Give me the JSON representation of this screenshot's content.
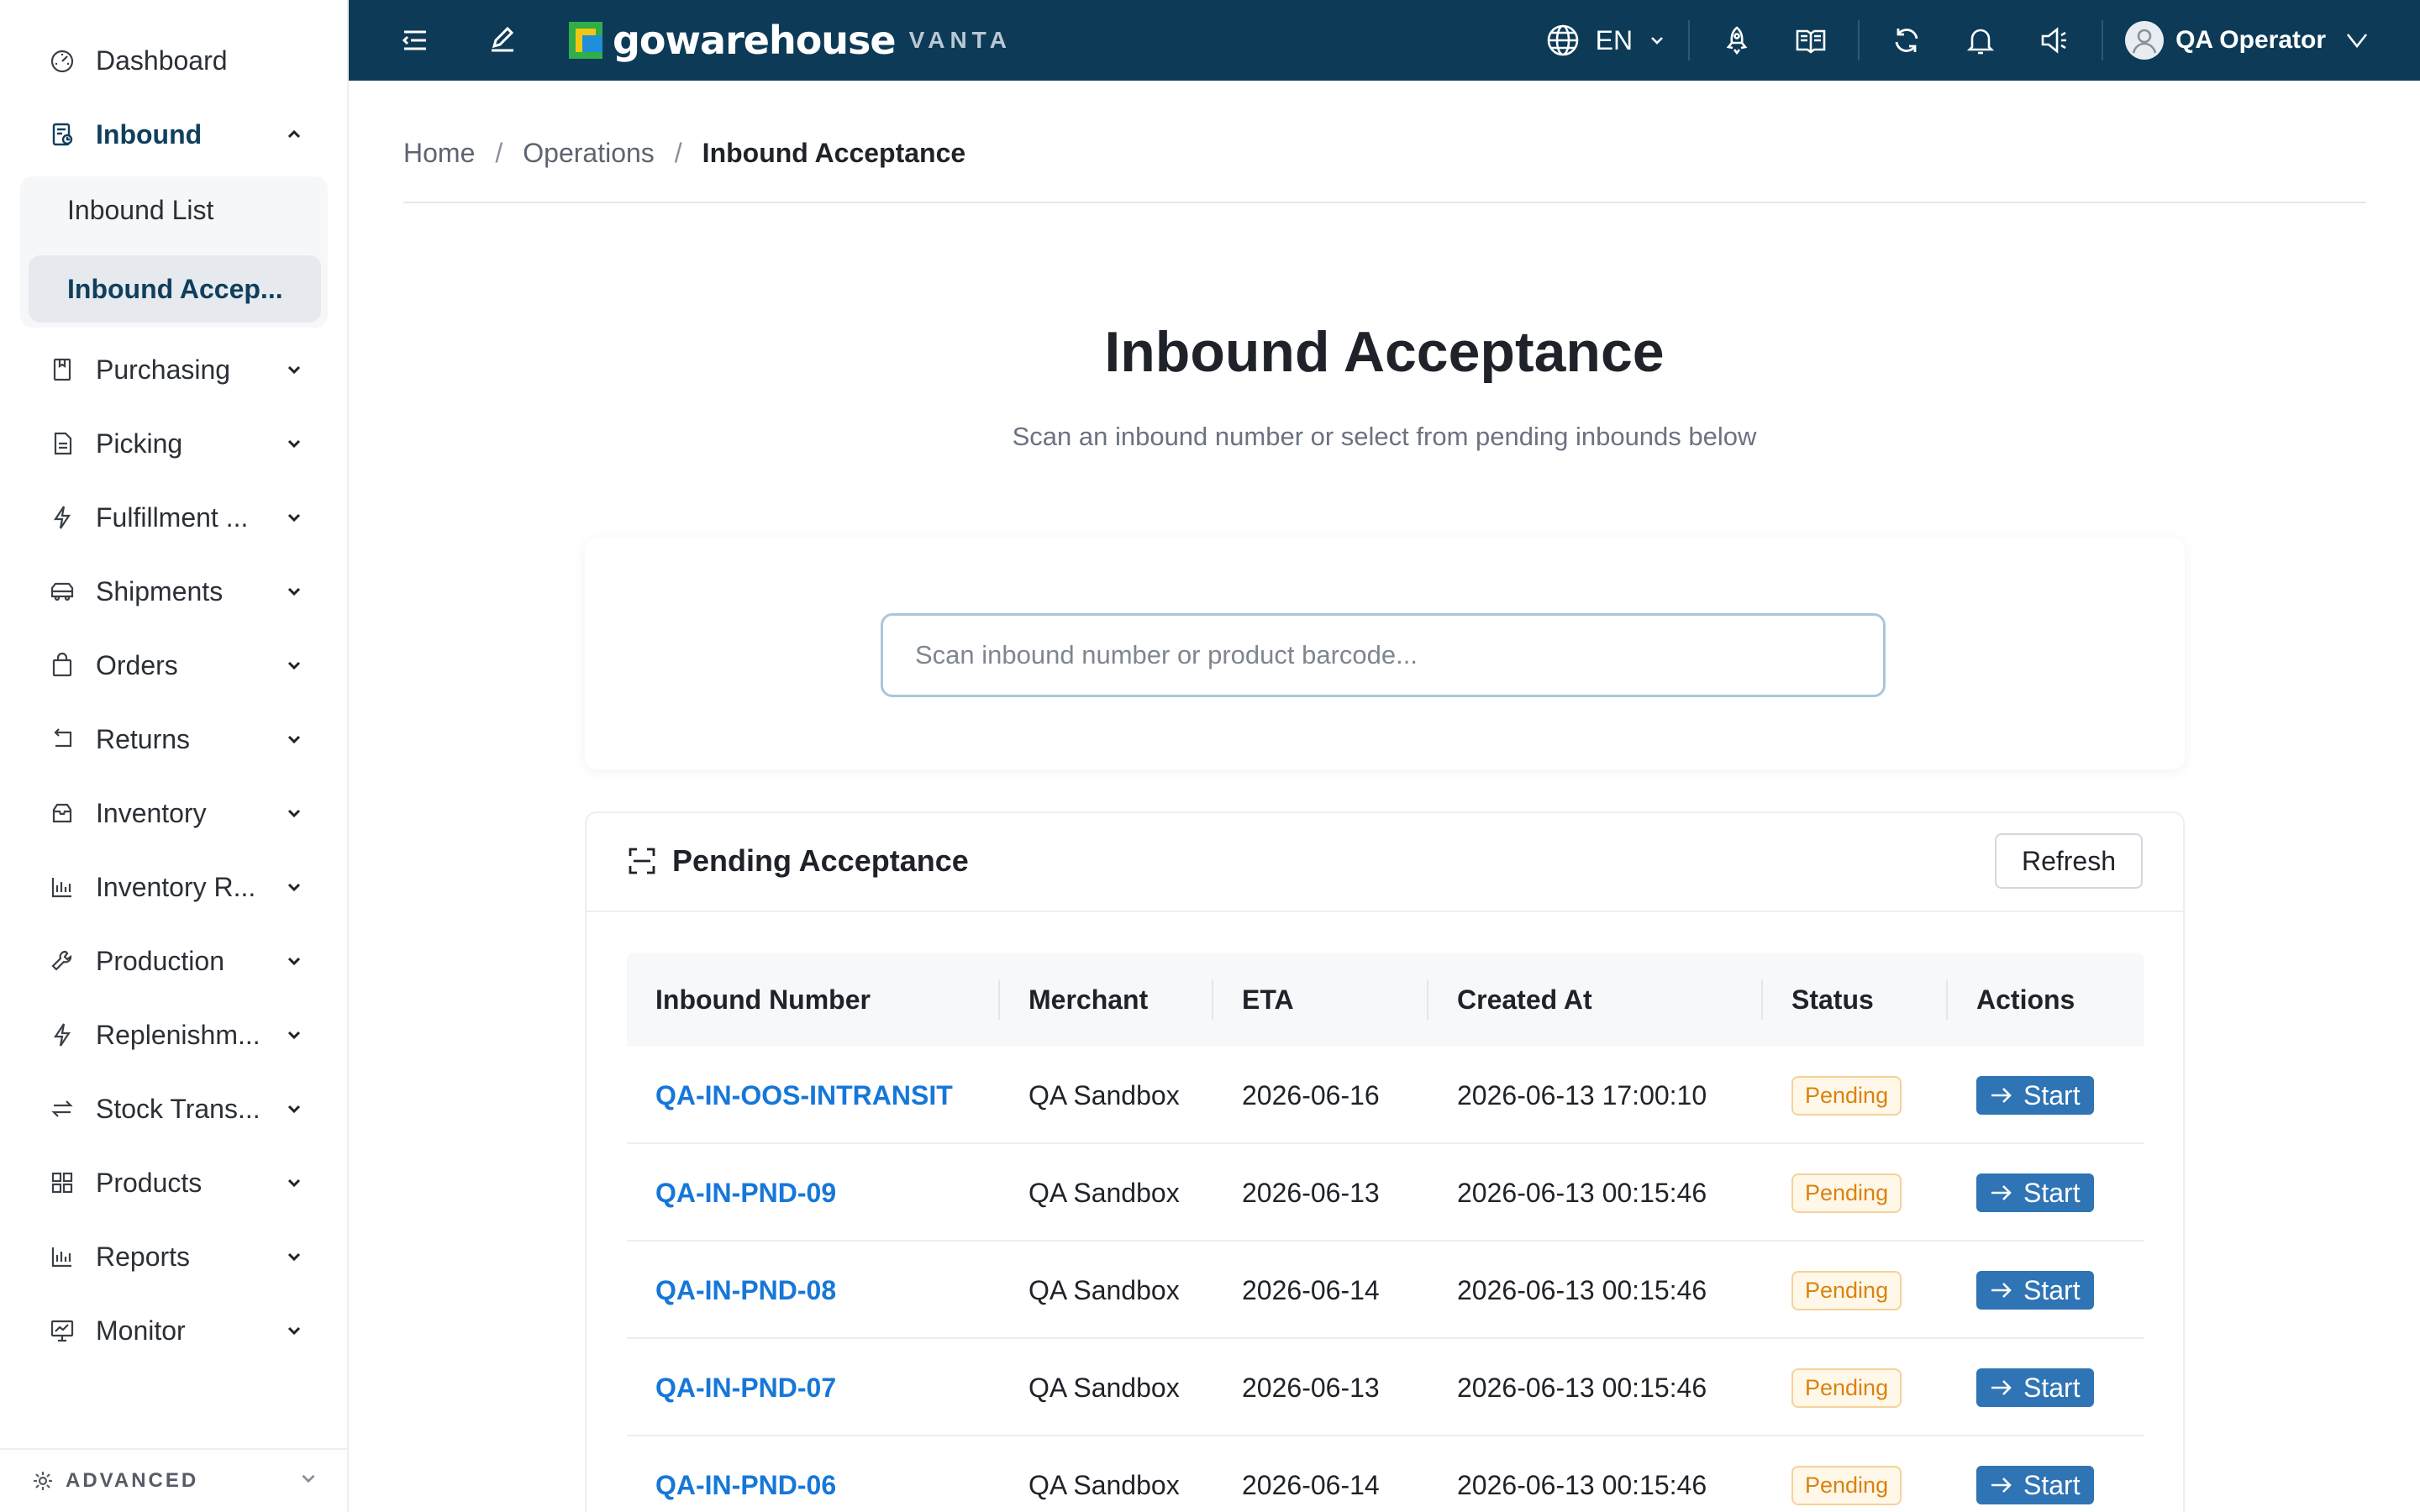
{
  "sidebar": {
    "items": [
      {
        "label": "Dashboard",
        "icon": "dashboard-gauge-icon"
      },
      {
        "label": "Inbound",
        "icon": "inbound-clipboard-icon",
        "expanded": true
      },
      {
        "label": "Purchasing",
        "icon": "purchasing-book-icon"
      },
      {
        "label": "Picking",
        "icon": "picking-document-icon"
      },
      {
        "label": "Fulfillment ...",
        "icon": "fulfillment-bolt-icon"
      },
      {
        "label": "Shipments",
        "icon": "shipments-truck-icon"
      },
      {
        "label": "Orders",
        "icon": "orders-bag-icon"
      },
      {
        "label": "Returns",
        "icon": "returns-arrow-icon"
      },
      {
        "label": "Inventory",
        "icon": "inventory-box-icon"
      },
      {
        "label": "Inventory R...",
        "icon": "inventory-reports-chart-icon"
      },
      {
        "label": "Production",
        "icon": "production-wrench-icon"
      },
      {
        "label": "Replenishm...",
        "icon": "replenishment-bolt-icon"
      },
      {
        "label": "Stock Trans...",
        "icon": "stock-transfer-arrows-icon"
      },
      {
        "label": "Products",
        "icon": "products-grid-icon"
      },
      {
        "label": "Reports",
        "icon": "reports-chart-icon"
      },
      {
        "label": "Monitor",
        "icon": "monitor-screen-icon"
      }
    ],
    "inbound_sub": [
      {
        "label": "Inbound List",
        "active": false
      },
      {
        "label": "Inbound Accep...",
        "active": true
      }
    ],
    "advanced_label": "ADVANCED"
  },
  "topbar": {
    "logo_text": "gowarehouse",
    "logo_sub": "VANTA",
    "language": "EN",
    "user_name": "QA Operator"
  },
  "breadcrumb": {
    "home": "Home",
    "section": "Operations",
    "current": "Inbound Acceptance"
  },
  "page": {
    "title": "Inbound Acceptance",
    "subtitle": "Scan an inbound number or select from pending inbounds below",
    "scan_placeholder": "Scan inbound number or product barcode..."
  },
  "pending": {
    "title": "Pending Acceptance",
    "refresh_label": "Refresh",
    "columns": [
      "Inbound Number",
      "Merchant",
      "ETA",
      "Created At",
      "Status",
      "Actions"
    ],
    "rows": [
      {
        "number": "QA-IN-OOS-INTRANSIT",
        "merchant": "QA Sandbox",
        "eta": "2026-06-16",
        "created": "2026-06-13 17:00:10",
        "status": "Pending",
        "action": "Start"
      },
      {
        "number": "QA-IN-PND-09",
        "merchant": "QA Sandbox",
        "eta": "2026-06-13",
        "created": "2026-06-13 00:15:46",
        "status": "Pending",
        "action": "Start"
      },
      {
        "number": "QA-IN-PND-08",
        "merchant": "QA Sandbox",
        "eta": "2026-06-14",
        "created": "2026-06-13 00:15:46",
        "status": "Pending",
        "action": "Start"
      },
      {
        "number": "QA-IN-PND-07",
        "merchant": "QA Sandbox",
        "eta": "2026-06-13",
        "created": "2026-06-13 00:15:46",
        "status": "Pending",
        "action": "Start"
      },
      {
        "number": "QA-IN-PND-06",
        "merchant": "QA Sandbox",
        "eta": "2026-06-14",
        "created": "2026-06-13 00:15:46",
        "status": "Pending",
        "action": "Start"
      }
    ]
  },
  "colors": {
    "topbar_bg": "#0d3b57",
    "active_text": "#0f3f5c",
    "link": "#1677d8",
    "start_button": "#2f74b4",
    "pending_badge": "#d98310"
  }
}
